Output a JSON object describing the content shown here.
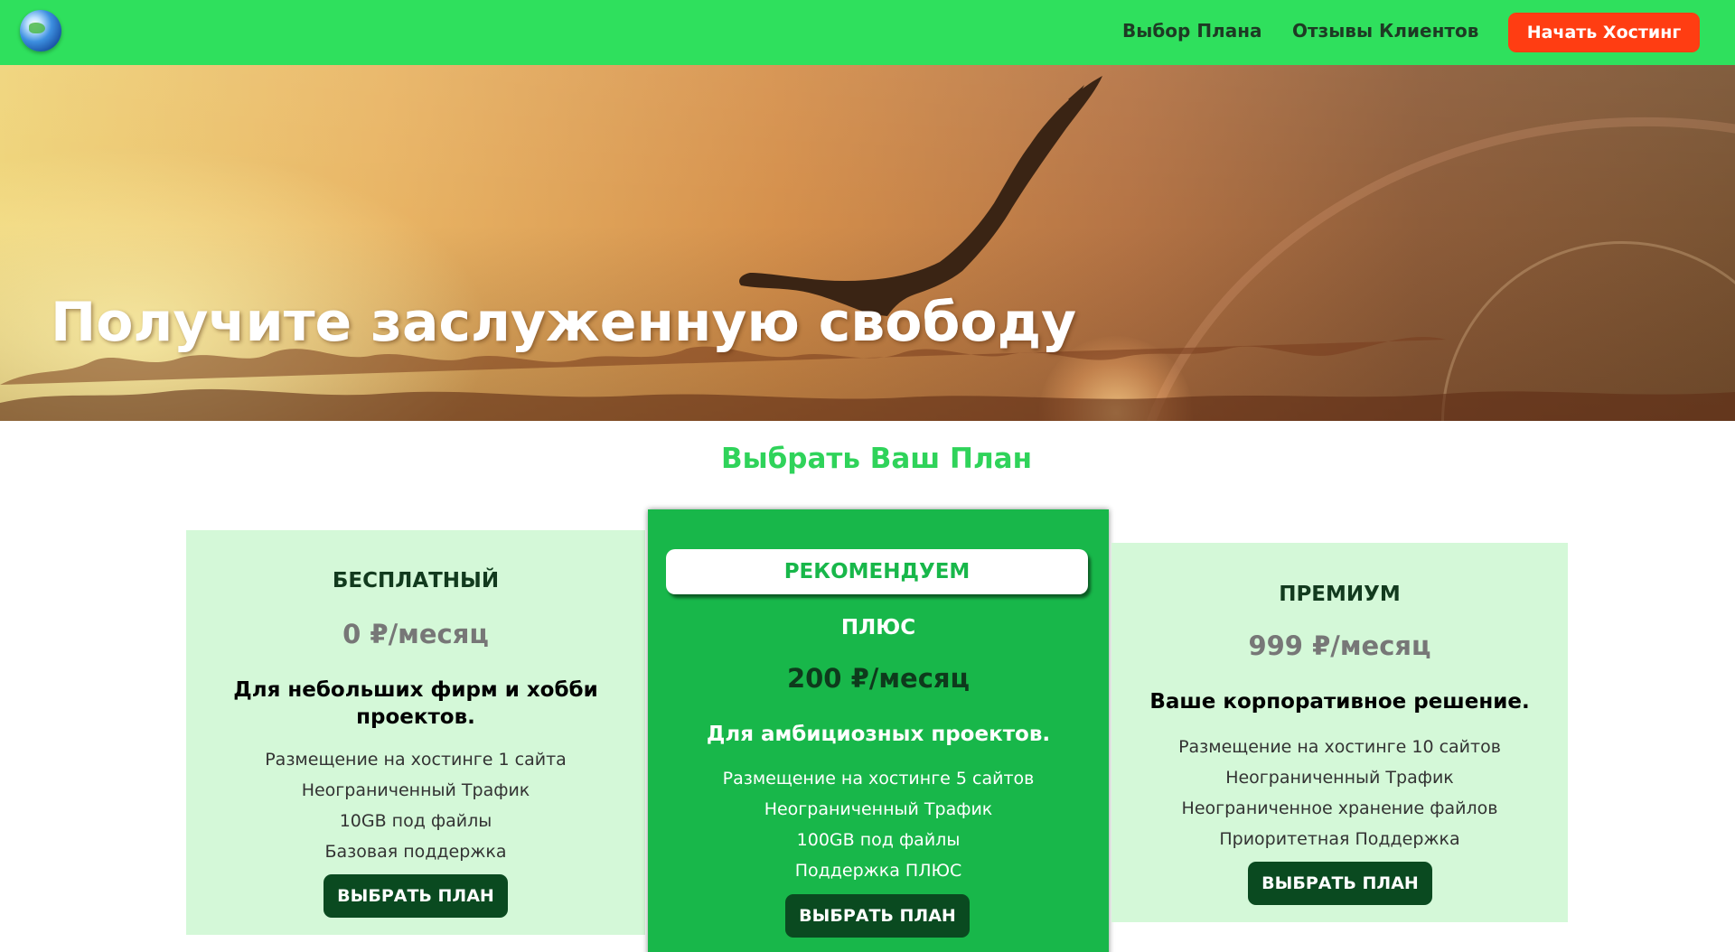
{
  "nav": {
    "logo_icon": "globe-icon",
    "links": [
      "Выбор Плана",
      "Отзывы Клиентов"
    ],
    "cta_label": "Начать Хостинг"
  },
  "hero": {
    "title": "Получите заслуженную свободу"
  },
  "pricing": {
    "title": "Выбрать Ваш План",
    "plans": [
      {
        "name": "БЕСПЛАТНЫЙ",
        "price": "0 ₽/месяц",
        "tagline": "Для небольших фирм и хобби проектов.",
        "features": [
          "Размещение на хостинге 1 сайта",
          "Неограниченный Трафик",
          "10GB под файлы",
          "Базовая поддержка"
        ],
        "button": "ВЫБРАТЬ ПЛАН"
      },
      {
        "badge": "РЕКОМЕНДУЕМ",
        "name": "ПЛЮС",
        "price": "200 ₽/месяц",
        "tagline": "Для амбициозных проектов.",
        "features": [
          "Размещение на хостинге 5 сайтов",
          "Неограниченный Трафик",
          "100GB под файлы",
          "Поддержка ПЛЮС"
        ],
        "button": "ВЫБРАТЬ ПЛАН"
      },
      {
        "name": "ПРЕМИУМ",
        "price": "999 ₽/месяц",
        "tagline": "Ваше корпоративное решение.",
        "features": [
          "Размещение на хостинге 10 сайтов",
          "Неограниченный Трафик",
          "Неограниченное хранение файлов",
          "Приоритетная Поддержка"
        ],
        "button": "ВЫБРАТЬ ПЛАН"
      }
    ]
  },
  "colors": {
    "nav_bg": "#2fe05d",
    "cta_bg": "#ff3d12",
    "accent_green": "#2fd35a",
    "card_light": "#d4f8d8",
    "card_featured": "#18b74a",
    "button_dark": "#0a4a20"
  }
}
